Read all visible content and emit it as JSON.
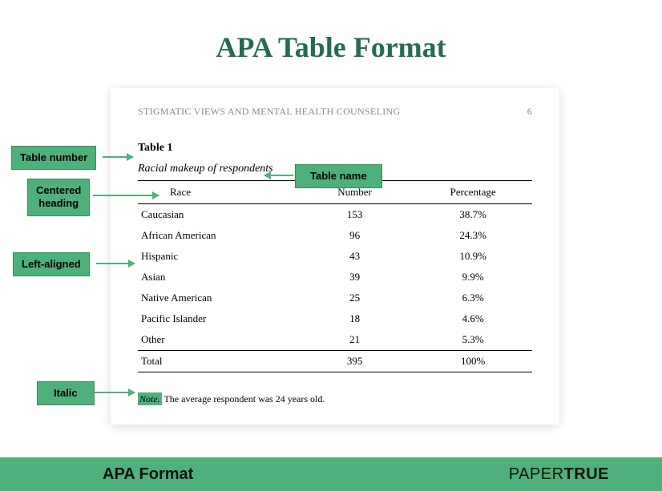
{
  "title": "APA Table Format",
  "doc": {
    "running_head": "STIGMATIC VIEWS AND MENTAL HEALTH COUNSELING",
    "page_number": "6",
    "table_number": "Table 1",
    "table_name": "Racial makeup of respondents",
    "columns": {
      "race": "Race",
      "number": "Number",
      "percentage": "Percentage"
    },
    "rows": [
      {
        "race": "Caucasian",
        "number": "153",
        "percentage": "38.7%"
      },
      {
        "race": "African American",
        "number": "96",
        "percentage": "24.3%"
      },
      {
        "race": "Hispanic",
        "number": "43",
        "percentage": "10.9%"
      },
      {
        "race": "Asian",
        "number": "39",
        "percentage": "9.9%"
      },
      {
        "race": "Native American",
        "number": "25",
        "percentage": "6.3%"
      },
      {
        "race": "Pacific Islander",
        "number": "18",
        "percentage": "4.6%"
      },
      {
        "race": "Other",
        "number": "21",
        "percentage": "5.3%"
      }
    ],
    "total": {
      "race": "Total",
      "number": "395",
      "percentage": "100%"
    },
    "note_label": "Note.",
    "note_text": " The average respondent was 24 years old."
  },
  "callouts": {
    "table_number": "Table number",
    "table_name": "Table name",
    "centered_heading": "Centered\nheading",
    "left_aligned": "Left-aligned",
    "italic": "Italic"
  },
  "footer": {
    "title": "APA Format",
    "brand_light": "PAPER",
    "brand_bold": "TRUE"
  }
}
